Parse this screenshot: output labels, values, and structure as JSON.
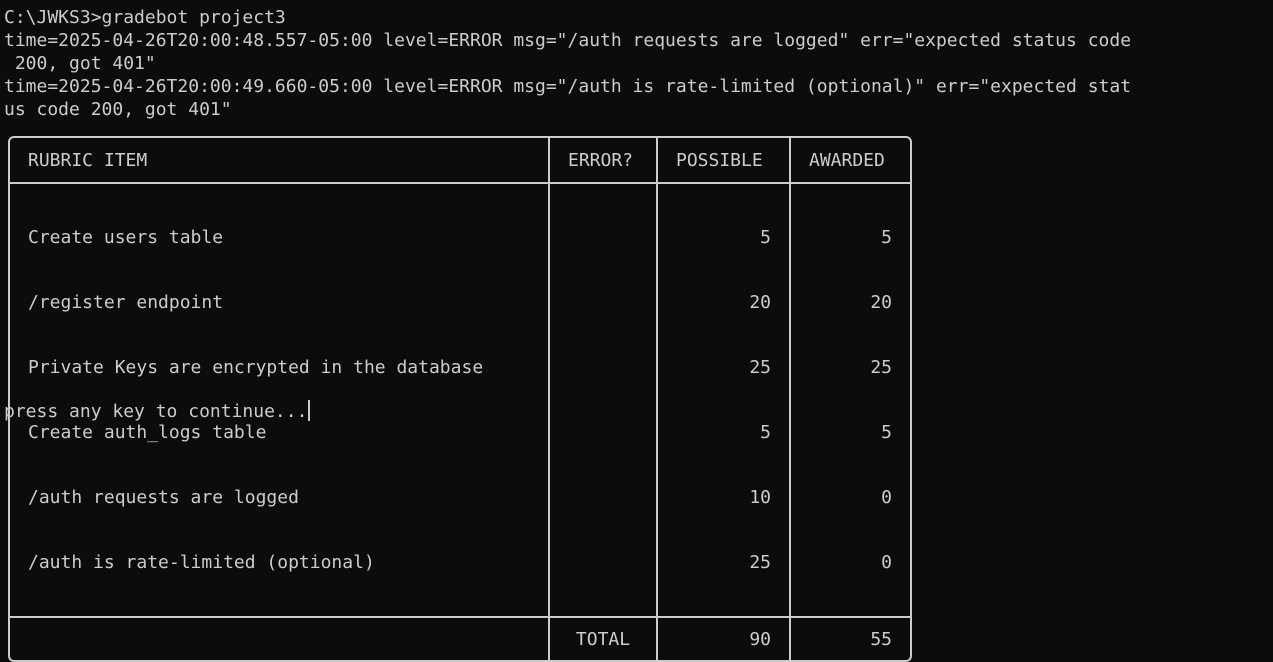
{
  "terminal": {
    "command_line": "C:\\JWKS3>gradebot project3",
    "log_lines": [
      "time=2025-04-26T20:00:48.557-05:00 level=ERROR msg=\"/auth requests are logged\" err=\"expected status code",
      " 200, got 401\"",
      "time=2025-04-26T20:00:49.660-05:00 level=ERROR msg=\"/auth is rate-limited (optional)\" err=\"expected stat",
      "us code 200, got 401\""
    ]
  },
  "rubric": {
    "headers": {
      "item": "RUBRIC ITEM",
      "error": "ERROR?",
      "possible": "POSSIBLE",
      "awarded": "AWARDED"
    },
    "rows": [
      {
        "item": "Create users table",
        "error": "",
        "possible": "5",
        "awarded": "5"
      },
      {
        "item": "/register endpoint",
        "error": "",
        "possible": "20",
        "awarded": "20"
      },
      {
        "item": "Private Keys are encrypted in the database",
        "error": "",
        "possible": "25",
        "awarded": "25"
      },
      {
        "item": "Create auth_logs table",
        "error": "",
        "possible": "5",
        "awarded": "5"
      },
      {
        "item": "/auth requests are logged",
        "error": "",
        "possible": "10",
        "awarded": "0"
      },
      {
        "item": "/auth is rate-limited (optional)",
        "error": "",
        "possible": "25",
        "awarded": "0"
      }
    ],
    "total": {
      "label": "TOTAL",
      "possible": "90",
      "awarded": "55"
    }
  },
  "prompt": {
    "text": "press any key to continue..."
  },
  "colors": {
    "background": "#0c0c0c",
    "foreground": "#cccccc"
  }
}
